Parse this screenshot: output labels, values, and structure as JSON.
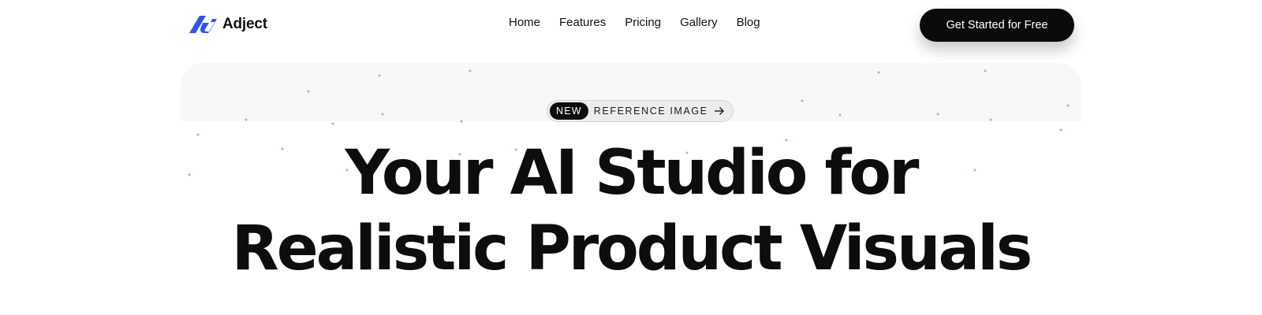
{
  "brand": {
    "name": "Adject",
    "logo_icon": "adject-logo-icon",
    "accent": "#2f55e8"
  },
  "nav": {
    "items": [
      {
        "label": "Home"
      },
      {
        "label": "Features"
      },
      {
        "label": "Pricing"
      },
      {
        "label": "Gallery"
      },
      {
        "label": "Blog"
      }
    ]
  },
  "cta": {
    "label": "Get Started for Free"
  },
  "hero": {
    "badge": {
      "tag": "NEW",
      "text": "REFERENCE IMAGE",
      "icon": "arrow-right-icon"
    },
    "headline_line1": "Your AI Studio for",
    "headline_line2": "Realistic Product Visuals"
  },
  "colors": {
    "dot": "#8f90e6",
    "hero_bg": "#f8f8f9",
    "cta_bg": "#0b0b0b"
  }
}
